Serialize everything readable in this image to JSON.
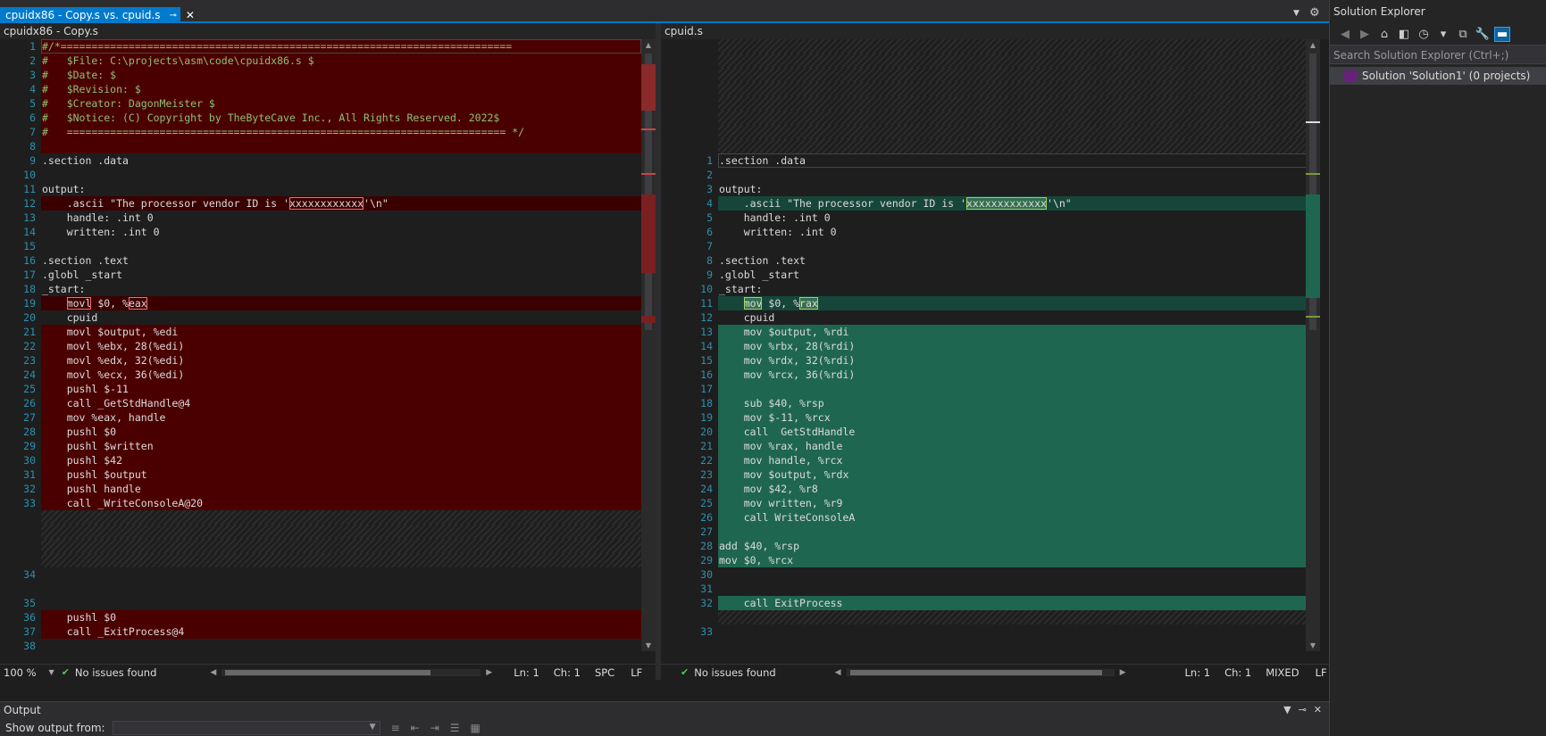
{
  "tab": {
    "title": "cpuidx86 - Copy.s vs. cpuid.s",
    "pin": "⊸",
    "close": "✕"
  },
  "tabstrip": {
    "dropdown": "▼",
    "settings": "⚙"
  },
  "left": {
    "file": "cpuidx86 - Copy.s",
    "lines": [
      {
        "n": "1",
        "t": "#/*=========================================================================",
        "k": "del comment cur"
      },
      {
        "n": "2",
        "t": "#   $File: C:\\projects\\asm\\code\\cpuidx86.s $",
        "k": "del comment"
      },
      {
        "n": "3",
        "t": "#   $Date: $",
        "k": "del comment"
      },
      {
        "n": "4",
        "t": "#   $Revision: $",
        "k": "del comment"
      },
      {
        "n": "5",
        "t": "#   $Creator: DagonMeister $",
        "k": "del comment"
      },
      {
        "n": "6",
        "t": "#   $Notice: (C) Copyright by TheByteCave Inc., All Rights Reserved. 2022$",
        "k": "del comment"
      },
      {
        "n": "7",
        "t": "#   ======================================================================= */",
        "k": "del comment"
      },
      {
        "n": "8",
        "t": "",
        "k": "del"
      },
      {
        "n": "9",
        "t": ".section .data",
        "k": ""
      },
      {
        "n": "10",
        "t": "",
        "k": ""
      },
      {
        "n": "11",
        "t": "output:",
        "k": ""
      },
      {
        "n": "12",
        "a": "    .ascii \"The processor vendor ID is '",
        "h": "xxxxxxxxxxxx",
        "b": "'\\n\"",
        "k": "del soft"
      },
      {
        "n": "13",
        "t": "    handle: .int 0",
        "k": ""
      },
      {
        "n": "14",
        "t": "    written: .int 0",
        "k": ""
      },
      {
        "n": "15",
        "t": "",
        "k": ""
      },
      {
        "n": "16",
        "t": ".section .text",
        "k": ""
      },
      {
        "n": "17",
        "t": ".globl _start",
        "k": ""
      },
      {
        "n": "18",
        "t": "_start:",
        "k": ""
      },
      {
        "n": "19",
        "a": "    ",
        "h": "movl",
        "b": " $0, %",
        "h2": "eax",
        "k": "del soft"
      },
      {
        "n": "20",
        "t": "    cpuid",
        "k": ""
      },
      {
        "n": "21",
        "t": "    movl $output, %edi",
        "k": "del"
      },
      {
        "n": "22",
        "t": "    movl %ebx, 28(%edi)",
        "k": "del"
      },
      {
        "n": "23",
        "t": "    movl %edx, 32(%edi)",
        "k": "del"
      },
      {
        "n": "24",
        "t": "    movl %ecx, 36(%edi)",
        "k": "del"
      },
      {
        "n": "25",
        "t": "    pushl $-11",
        "k": "del"
      },
      {
        "n": "26",
        "t": "    call _GetStdHandle@4",
        "k": "del"
      },
      {
        "n": "27",
        "t": "    mov %eax, handle",
        "k": "del"
      },
      {
        "n": "28",
        "t": "    pushl $0",
        "k": "del"
      },
      {
        "n": "29",
        "t": "    pushl $written",
        "k": "del"
      },
      {
        "n": "30",
        "t": "    pushl $42",
        "k": "del"
      },
      {
        "n": "31",
        "t": "    pushl $output",
        "k": "del"
      },
      {
        "n": "32",
        "t": "    pushl handle",
        "k": "del"
      },
      {
        "n": "33",
        "t": "    call _WriteConsoleA@20",
        "k": "del"
      },
      {
        "n": "",
        "t": "",
        "k": "hatch"
      },
      {
        "n": "",
        "t": "",
        "k": "hatch"
      },
      {
        "n": "",
        "t": "",
        "k": "hatch"
      },
      {
        "n": "",
        "t": "",
        "k": "hatch"
      },
      {
        "n": "34",
        "t": "",
        "k": ""
      },
      {
        "n": "",
        "t": "",
        "k": ""
      },
      {
        "n": "35",
        "t": "",
        "k": ""
      },
      {
        "n": "36",
        "t": "    pushl $0",
        "k": "del"
      },
      {
        "n": "37",
        "t": "    call _ExitProcess@4",
        "k": "del"
      },
      {
        "n": "38",
        "t": "",
        "k": ""
      }
    ],
    "status": {
      "zoom": "100 %",
      "issues": "No issues found",
      "ln": "Ln: 1",
      "ch": "Ch: 1",
      "mode": "SPC",
      "eol": "LF"
    }
  },
  "right": {
    "file": "cpuid.s",
    "lines": [
      {
        "n": "",
        "t": "",
        "k": "hatch"
      },
      {
        "n": "",
        "t": "",
        "k": "hatch"
      },
      {
        "n": "",
        "t": "",
        "k": "hatch"
      },
      {
        "n": "",
        "t": "",
        "k": "hatch"
      },
      {
        "n": "",
        "t": "",
        "k": "hatch"
      },
      {
        "n": "",
        "t": "",
        "k": "hatch"
      },
      {
        "n": "",
        "t": "",
        "k": "hatch"
      },
      {
        "n": "",
        "t": "",
        "k": "hatch"
      },
      {
        "n": "1",
        "t": ".section .data",
        "k": "cur"
      },
      {
        "n": "2",
        "t": "",
        "k": ""
      },
      {
        "n": "3",
        "t": "output:",
        "k": ""
      },
      {
        "n": "4",
        "a": "    .ascii \"The processor vendor ID is '",
        "h": "xxxxxxxxxxxxx",
        "b": "'\\n\"",
        "k": "add soft"
      },
      {
        "n": "5",
        "t": "    handle: .int 0",
        "k": ""
      },
      {
        "n": "6",
        "t": "    written: .int 0",
        "k": ""
      },
      {
        "n": "7",
        "t": "",
        "k": ""
      },
      {
        "n": "8",
        "t": ".section .text",
        "k": ""
      },
      {
        "n": "9",
        "t": ".globl _start",
        "k": ""
      },
      {
        "n": "10",
        "t": "_start:",
        "k": ""
      },
      {
        "n": "11",
        "a": "    ",
        "h": "mov",
        "b": " $0, %",
        "h2": "rax",
        "k": "add soft"
      },
      {
        "n": "12",
        "t": "    cpuid",
        "k": ""
      },
      {
        "n": "13",
        "t": "    mov $output, %rdi",
        "k": "add"
      },
      {
        "n": "14",
        "t": "    mov %rbx, 28(%rdi)",
        "k": "add"
      },
      {
        "n": "15",
        "t": "    mov %rdx, 32(%rdi)",
        "k": "add"
      },
      {
        "n": "16",
        "t": "    mov %rcx, 36(%rdi)",
        "k": "add"
      },
      {
        "n": "17",
        "t": "",
        "k": "add"
      },
      {
        "n": "18",
        "t": "    sub $40, %rsp",
        "k": "add"
      },
      {
        "n": "19",
        "t": "    mov $-11, %rcx",
        "k": "add"
      },
      {
        "n": "20",
        "t": "    call  GetStdHandle",
        "k": "add"
      },
      {
        "n": "21",
        "t": "    mov %rax, handle",
        "k": "add"
      },
      {
        "n": "22",
        "t": "    mov handle, %rcx",
        "k": "add"
      },
      {
        "n": "23",
        "t": "    mov $output, %rdx",
        "k": "add"
      },
      {
        "n": "24",
        "t": "    mov $42, %r8",
        "k": "add"
      },
      {
        "n": "25",
        "t": "    mov written, %r9",
        "k": "add"
      },
      {
        "n": "26",
        "t": "    call WriteConsoleA",
        "k": "add"
      },
      {
        "n": "27",
        "t": "",
        "k": "add"
      },
      {
        "n": "28",
        "t": "add $40, %rsp",
        "k": "add"
      },
      {
        "n": "29",
        "t": "mov $0, %rcx",
        "k": "add"
      },
      {
        "n": "30",
        "t": "",
        "k": ""
      },
      {
        "n": "31",
        "t": "",
        "k": ""
      },
      {
        "n": "32",
        "t": "    call ExitProcess",
        "k": "add"
      },
      {
        "n": "",
        "t": "",
        "k": "hatch"
      },
      {
        "n": "33",
        "t": "",
        "k": ""
      }
    ],
    "status": {
      "issues": "No issues found",
      "ln": "Ln: 1",
      "ch": "Ch: 1",
      "mode": "MIXED",
      "eol": "LF"
    }
  },
  "solution_explorer": {
    "title": "Solution Explorer",
    "toolbar": [
      "◀",
      "▶",
      "⌂",
      "◧",
      "◷",
      "▾",
      "⧉",
      "🔧",
      "▬"
    ],
    "search_placeholder": "Search Solution Explorer (Ctrl+;)",
    "solution": "Solution 'Solution1' (0 projects)"
  },
  "output": {
    "title": "Output",
    "show_from": "Show output from:",
    "controls": [
      "▼",
      "⊸",
      "✕"
    ],
    "dropdown": "▼",
    "icons": [
      "≡",
      "⇤",
      "⇥",
      "☰",
      "▦"
    ]
  },
  "colors": {
    "accent": "#007acc",
    "deleted": "#4b0000",
    "added": "#1f6650",
    "line_number": "#2b91af",
    "comment": "#57a64a"
  }
}
